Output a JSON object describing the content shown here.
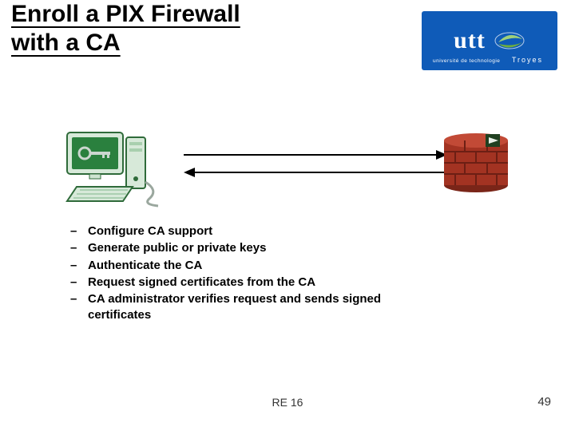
{
  "title_line1": "Enroll a PIX Firewall",
  "title_line2": "with a CA",
  "logo": {
    "text": "utt",
    "subtitle": "université de technologie",
    "city": "Troyes"
  },
  "diagram": {
    "left_icon": "computer-with-key-icon",
    "right_icon": "brick-firewall-icon",
    "arrow_top": "right-arrow",
    "arrow_bottom": "left-arrow"
  },
  "bullets": [
    "Configure CA support",
    "Generate public or private keys",
    "Authenticate the CA",
    "Request signed certificates from the CA",
    "CA administrator verifies request and sends signed certificates"
  ],
  "footer": {
    "code": "RE 16",
    "page": "49"
  }
}
